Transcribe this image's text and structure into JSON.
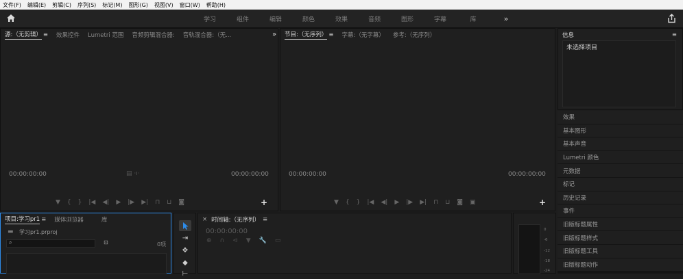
{
  "menu": [
    "文件(F)",
    "编辑(E)",
    "剪辑(C)",
    "序列(S)",
    "标记(M)",
    "图形(G)",
    "视图(V)",
    "窗口(W)",
    "帮助(H)"
  ],
  "workspaces": [
    "学习",
    "组件",
    "编辑",
    "颜色",
    "效果",
    "音频",
    "图形",
    "字幕",
    "库"
  ],
  "workspace_more": "»",
  "source": {
    "tabs": [
      "源:（无剪辑）",
      "效果控件",
      "Lumetri 范围",
      "音频剪辑混合器:",
      "音轨混合器:（无..."
    ],
    "more": "»",
    "timecode_left": "00:00:00:00",
    "timecode_right": "00:00:00:00"
  },
  "program": {
    "tabs": [
      "节目:（无序列）",
      "字幕:（无字幕）",
      "参考:（无序列）"
    ],
    "timecode_left": "00:00:00:00",
    "timecode_right": "00:00:00:00"
  },
  "info": {
    "title": "信息",
    "content": "未选择项目"
  },
  "side_panels": [
    "效果",
    "基本图形",
    "基本声音",
    "Lumetri 颜色",
    "元数据",
    "标记",
    "历史记录",
    "事件",
    "旧版标题属性",
    "旧版标题样式",
    "旧版标题工具",
    "旧版标题动作"
  ],
  "project": {
    "tabs": [
      "项目:学习pr1",
      "媒体浏览器",
      "库"
    ],
    "file": "学习pr1.prproj",
    "item_count": "0项"
  },
  "timeline": {
    "title": "时间轴:（无序列）",
    "timecode": "00:00:00:00"
  },
  "meter_ticks": [
    "0",
    "-6",
    "-12",
    "-18",
    "-24"
  ],
  "icons": [
    "home-icon",
    "share-icon",
    "selection-tool-icon",
    "track-select-icon",
    "ripple-edit-icon",
    "razor-tool-icon",
    "wrench-icon",
    "search-icon",
    "folder-icon"
  ],
  "colors": {
    "menubar": "#f2f2f2",
    "panel": "#1f1f1f",
    "accent": "#2d8ceb",
    "active_tool": "#3a3a3a"
  }
}
